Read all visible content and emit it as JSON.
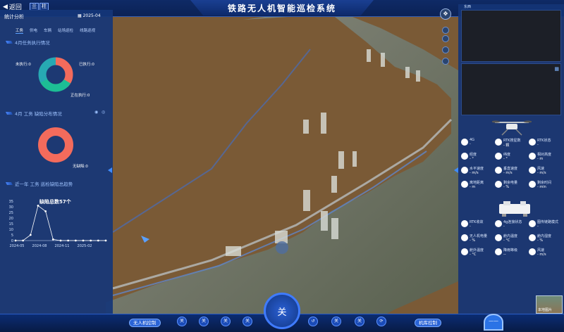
{
  "header": {
    "back_label": "返回",
    "chip1": "兰",
    "chip2": "柱",
    "title": "铁路无人机智能巡检系统"
  },
  "left_panel": {
    "title": "统计分析",
    "date": "2025-04",
    "tabs": [
      "工务",
      "供电",
      "车辆",
      "站场巡检",
      "线路巡视"
    ],
    "task_section": {
      "title": "4月任务执行情况",
      "labels": {
        "not_executed": "未执行:0",
        "executed": "已执行:0",
        "executing": "正在执行:0"
      }
    },
    "defect_section": {
      "title": "4月  工务 缺陷分布情况",
      "labels": {
        "no_defect": "无缺陷:0"
      }
    },
    "trend_section": {
      "title": "近一年  工务  巡检缺陷总趋势",
      "total": "缺陷总数57个"
    }
  },
  "chart_data": {
    "type": "line",
    "title": "缺陷总数57个",
    "x_ticks": [
      "2024-05",
      "2024-08",
      "2024-11",
      "2025-02"
    ],
    "y_ticks": [
      0,
      5,
      10,
      15,
      20,
      25,
      30,
      35
    ],
    "ylim": [
      0,
      35
    ],
    "series": [
      {
        "values": [
          0,
          0,
          5,
          31,
          26,
          1,
          0,
          0,
          0,
          0,
          0,
          0,
          0
        ]
      }
    ]
  },
  "right_panel": {
    "top_label": "东西",
    "fields": [
      {
        "key": "4G",
        "val": "-",
        "icon": "signal-icon"
      },
      {
        "key": "RTK搜星数",
        "val": "- 颗",
        "icon": "satellite-icon"
      },
      {
        "key": "RTK状态",
        "val": "-",
        "icon": "rtk-status-icon"
      },
      {
        "key": "经度",
        "val": "- °",
        "icon": "longitude-icon"
      },
      {
        "key": "纬度",
        "val": "- °",
        "icon": "latitude-icon"
      },
      {
        "key": "相对高度",
        "val": "- m",
        "icon": "height-icon"
      },
      {
        "key": "水平速度",
        "val": "- m/s",
        "icon": "hspeed-icon"
      },
      {
        "key": "垂直速度",
        "val": "- m/s",
        "icon": "vspeed-icon"
      },
      {
        "key": "风速",
        "val": "- m/s",
        "icon": "wind-icon"
      },
      {
        "key": "离地距离",
        "val": "- m",
        "icon": "distance-icon"
      },
      {
        "key": "剩余电量",
        "val": "- %",
        "icon": "battery-icon"
      },
      {
        "key": "剩余时间",
        "val": "- min",
        "icon": "timer-icon"
      }
    ],
    "dock_fields": [
      {
        "key": "RTK收敛",
        "val": "-",
        "icon": "rtk-icon"
      },
      {
        "key": "4g连接状态",
        "val": "-",
        "icon": "4g-icon"
      },
      {
        "key": "图传链路模式",
        "val": "-",
        "icon": "link-icon"
      },
      {
        "key": "无人机电量",
        "val": "- %",
        "icon": "drone-battery-icon"
      },
      {
        "key": "舱内温度",
        "val": "- °C",
        "icon": "temp-icon"
      },
      {
        "key": "舱内湿度",
        "val": "- %",
        "icon": "humidity-icon"
      },
      {
        "key": "舱外温度",
        "val": "- °C",
        "icon": "outer-temp-icon"
      },
      {
        "key": "降雨等级",
        "val": "--",
        "icon": "rain-icon"
      },
      {
        "key": "风速",
        "val": "- m/s",
        "icon": "wind-icon"
      }
    ]
  },
  "bottom": {
    "left_btn": "无人机控制",
    "right_btn": "机库控制",
    "center": "关",
    "icon_label": "关",
    "right_circle": "——",
    "thumb_label": "本地图片"
  },
  "colors": {
    "ring": "#f36b5c",
    "ring2": "#27b28a",
    "panel": "#153678",
    "accent": "#2a63d6"
  }
}
